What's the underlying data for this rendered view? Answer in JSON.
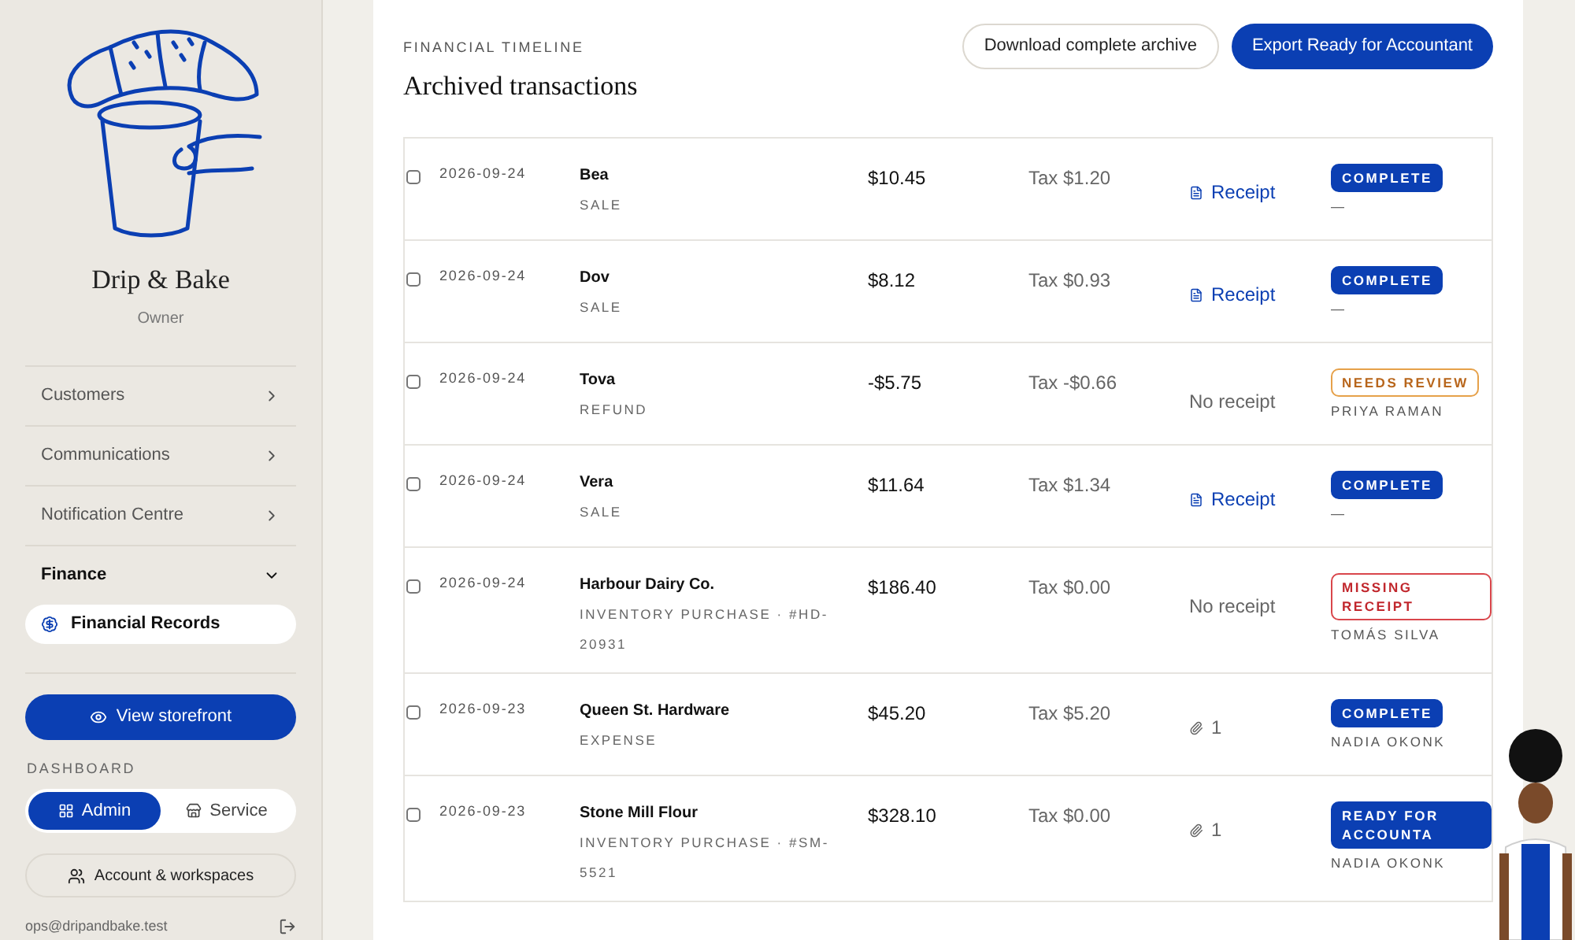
{
  "brand": {
    "name": "Drip & Bake",
    "role": "Owner"
  },
  "nav": [
    {
      "label": "Customers",
      "expanded": false
    },
    {
      "label": "Communications",
      "expanded": false
    },
    {
      "label": "Notification Centre",
      "expanded": false
    },
    {
      "label": "Finance",
      "expanded": true,
      "children": [
        {
          "label": "Financial Records",
          "selected": true
        }
      ]
    }
  ],
  "storefront_button": "View storefront",
  "dashboard": {
    "label": "DASHBOARD",
    "options": [
      {
        "label": "Admin",
        "selected": true
      },
      {
        "label": "Service",
        "selected": false
      }
    ]
  },
  "account_button": "Account & workspaces",
  "email": "ops@dripandbake.test",
  "header": {
    "eyebrow": "FINANCIAL TIMELINE",
    "title": "Archived transactions",
    "buttons": [
      {
        "label": "Download complete archive",
        "kind": "outline"
      },
      {
        "label": "Export Ready for Accountant",
        "kind": "primary"
      }
    ]
  },
  "rows": [
    {
      "checked": false,
      "date": "2026-09-24",
      "name": "Bea",
      "type": "SALE",
      "amount": "$10.45",
      "tax": "Tax $1.20",
      "receipt": {
        "kind": "link",
        "text": "Receipt"
      },
      "status": {
        "kind": "complete",
        "label": "COMPLETE"
      },
      "assignee": "—"
    },
    {
      "checked": false,
      "date": "2026-09-24",
      "name": "Dov",
      "type": "SALE",
      "amount": "$8.12",
      "tax": "Tax $0.93",
      "receipt": {
        "kind": "link",
        "text": "Receipt"
      },
      "status": {
        "kind": "complete",
        "label": "COMPLETE"
      },
      "assignee": "—"
    },
    {
      "checked": false,
      "date": "2026-09-24",
      "name": "Tova",
      "type": "REFUND",
      "amount": "-$5.75",
      "tax": "Tax -$0.66",
      "receipt": {
        "kind": "none",
        "text": "No receipt"
      },
      "status": {
        "kind": "review",
        "label": "NEEDS REVIEW"
      },
      "assignee": "PRIYA RAMAN"
    },
    {
      "checked": false,
      "date": "2026-09-24",
      "name": "Vera",
      "type": "SALE",
      "amount": "$11.64",
      "tax": "Tax $1.34",
      "receipt": {
        "kind": "link",
        "text": "Receipt"
      },
      "status": {
        "kind": "complete",
        "label": "COMPLETE"
      },
      "assignee": "—"
    },
    {
      "checked": false,
      "date": "2026-09-24",
      "name": "Harbour Dairy Co.",
      "type": "INVENTORY PURCHASE · #HD-20931",
      "amount": "$186.40",
      "tax": "Tax $0.00",
      "receipt": {
        "kind": "none",
        "text": "No receipt"
      },
      "status": {
        "kind": "missing",
        "label": "MISSING RECEIPT"
      },
      "assignee": "TOMÁS SILVA"
    },
    {
      "checked": false,
      "date": "2026-09-23",
      "name": "Queen St. Hardware",
      "type": "EXPENSE",
      "amount": "$45.20",
      "tax": "Tax $5.20",
      "receipt": {
        "kind": "attachment",
        "text": "1"
      },
      "status": {
        "kind": "complete",
        "label": "COMPLETE"
      },
      "assignee": "NADIA OKONK"
    },
    {
      "checked": false,
      "date": "2026-09-23",
      "name": "Stone Mill Flour",
      "type": "INVENTORY PURCHASE · #SM-5521",
      "amount": "$328.10",
      "tax": "Tax $0.00",
      "receipt": {
        "kind": "attachment",
        "text": "1"
      },
      "status": {
        "kind": "ready",
        "label": "READY FOR ACCOUNTA"
      },
      "assignee": "NADIA OKONK"
    }
  ]
}
